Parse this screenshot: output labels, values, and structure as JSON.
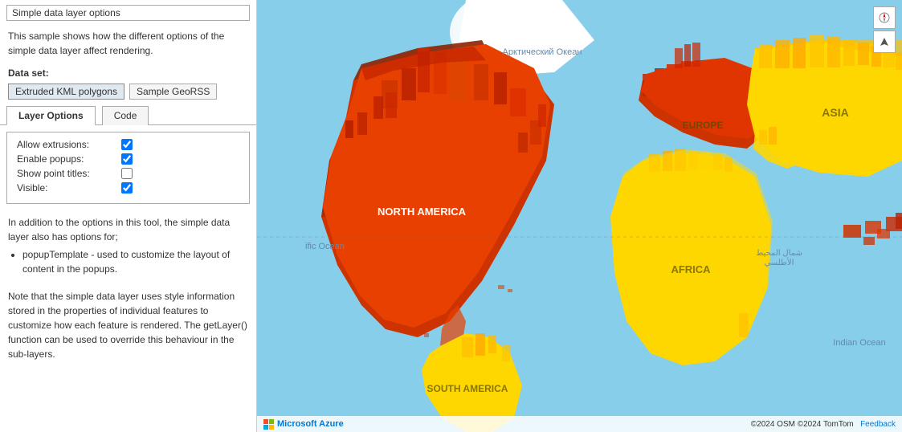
{
  "panel": {
    "section_header": "Simple data layer options",
    "description": "This sample shows how the different options of the simple data layer affect rendering.",
    "dataset_label": "Data set:",
    "buttons": [
      {
        "label": "Extruded KML polygons",
        "active": true
      },
      {
        "label": "Sample GeoRSS",
        "active": false
      }
    ],
    "tabs": [
      {
        "label": "Layer Options",
        "active": true
      },
      {
        "label": "Code",
        "active": false
      }
    ],
    "options": [
      {
        "label": "Allow extrusions:",
        "checked": true,
        "name": "allow-extrusions"
      },
      {
        "label": "Enable popups:",
        "checked": true,
        "name": "enable-popups"
      },
      {
        "label": "Show point titles:",
        "checked": false,
        "name": "show-point-titles"
      },
      {
        "label": "Visible:",
        "checked": true,
        "name": "visible"
      }
    ],
    "info1": "In addition to the options in this tool, the simple data layer also has options for;",
    "info_list": [
      "popupTemplate - used to customize the layout of content in the popups."
    ],
    "info2": "Note that the simple data layer uses style information stored in the properties of individual features to customize how each feature is rendered. The getLayer() function can be used to override this behaviour in the sub-layers."
  },
  "map": {
    "labels": {
      "arctic": "Арктический Океан",
      "north_america": "NORTH AMERICA",
      "south_america": "SOUTH AMERICA",
      "europe": "EUROPE",
      "africa": "AFRICA",
      "asia": "ASIA",
      "atlantic": "ific Ocean",
      "atlantic2": "شمال المحيط الأطلسي",
      "indian": "Indian Ocean"
    },
    "footer": {
      "brand": "Microsoft Azure",
      "copyright": "©2024 OSM ©2024 TomTom",
      "feedback": "Feedback"
    },
    "controls": {
      "compass": "⊕",
      "user": "▲"
    }
  }
}
